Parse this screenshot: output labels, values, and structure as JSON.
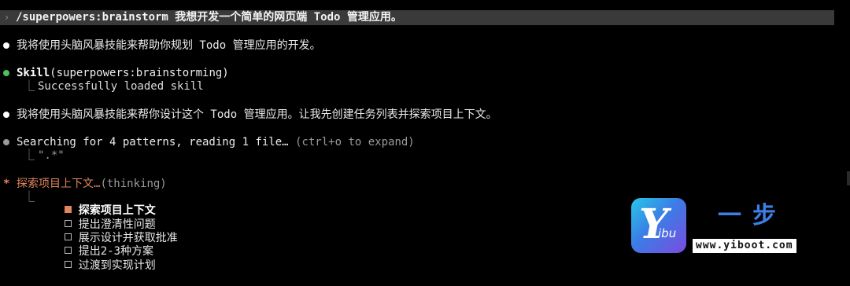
{
  "prompt": {
    "chevron": "›",
    "text": "/superpowers:brainstorm 我想开发一个简单的网页端 Todo 管理应用。"
  },
  "messages": [
    {
      "bullet": "white",
      "text": "我将使用头脑风暴技能来帮助你规划 Todo 管理应用的开发。"
    },
    {
      "bullet": "green",
      "tool_name": "Skill",
      "tool_args": "(superpowers:brainstorming)",
      "result": "Successfully loaded skill"
    },
    {
      "bullet": "white",
      "text": "我将使用头脑风暴技能来帮你设计这个 Todo 管理应用。让我先创建任务列表并探索项目上下文。"
    },
    {
      "bullet": "grey",
      "text": "Searching for 4 patterns, reading 1 file…",
      "hint": "(ctrl+o to expand)",
      "result": "\".*\""
    }
  ],
  "status": {
    "icon": "*",
    "text": "探索项目上下文…",
    "state": "(thinking)"
  },
  "tasks": [
    {
      "label": "探索项目上下文",
      "active": true
    },
    {
      "label": "提出澄清性问题",
      "active": false
    },
    {
      "label": "展示设计并获取批准",
      "active": false
    },
    {
      "label": "提出2-3种方案",
      "active": false
    },
    {
      "label": "过渡到实现计划",
      "active": false
    }
  ],
  "tree_glyph": "⎿",
  "watermark": {
    "logo_mark": "Y",
    "logo_text": "ibu",
    "brand_cn": "一步",
    "url": "www.yiboot.com",
    "brand_color": "#3e7fe6"
  },
  "colors": {
    "accent_orange": "#e0855e",
    "success_green": "#4cc259",
    "prompt_bg": "#3a3a3a",
    "background": "#000000"
  }
}
